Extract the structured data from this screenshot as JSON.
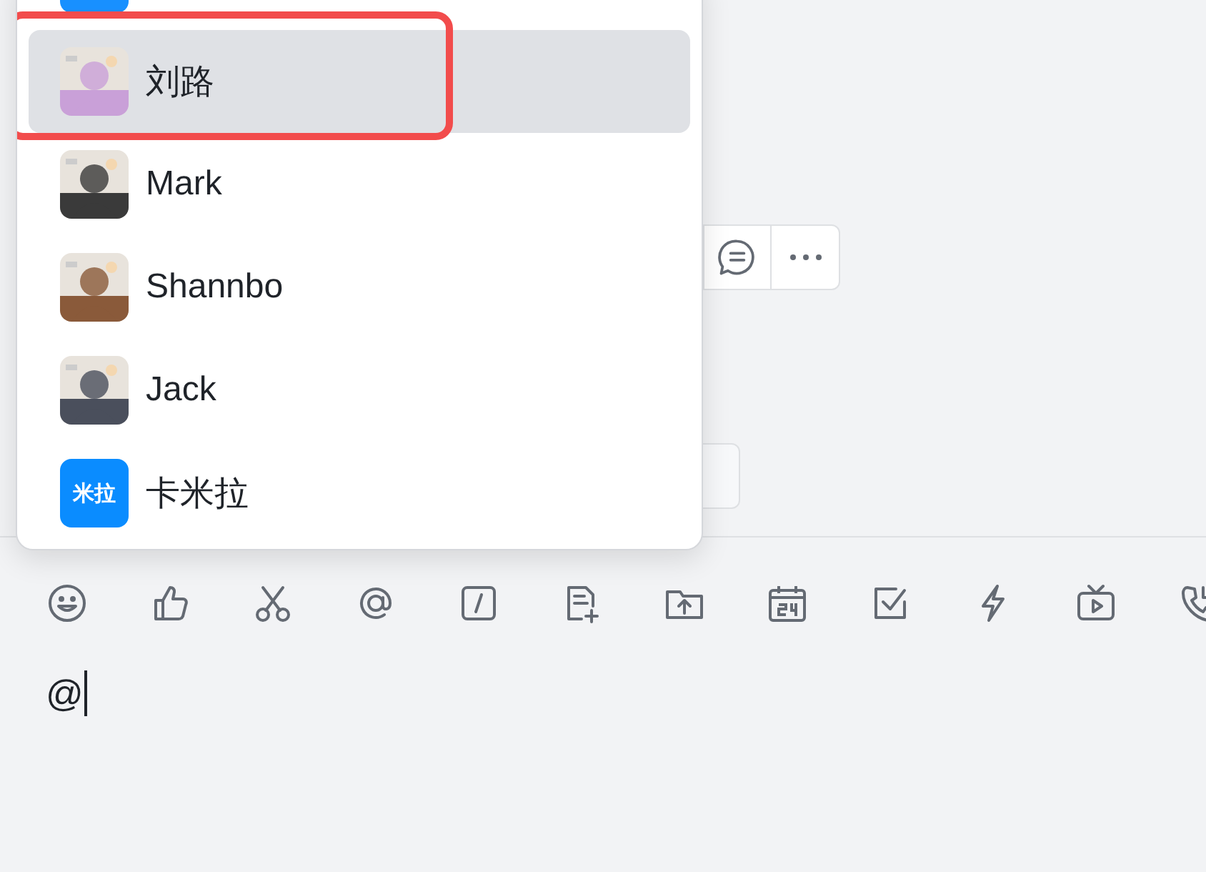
{
  "mention_popup": {
    "members": [
      {
        "selected": false,
        "avatar": {
          "kind": "tile",
          "color": "#1890ff"
        }
      },
      {
        "name": "刘路",
        "selected": true,
        "highlighted": true
      },
      {
        "name": "Mark",
        "selected": false
      },
      {
        "name": "Shannbo",
        "selected": false
      },
      {
        "name": "Jack",
        "selected": false
      },
      {
        "name": "卡米拉",
        "selected": false,
        "avatar": {
          "kind": "text",
          "text": "米拉",
          "color": "#0a8cff"
        }
      }
    ]
  },
  "composer": {
    "toolbar": [
      {
        "kind": "emoji"
      },
      {
        "kind": "like"
      },
      {
        "kind": "scissors"
      },
      {
        "kind": "at"
      },
      {
        "kind": "slash"
      },
      {
        "kind": "doc-add"
      },
      {
        "kind": "folder-upload"
      },
      {
        "kind": "calendar"
      },
      {
        "kind": "checkbox"
      },
      {
        "kind": "lightning"
      },
      {
        "kind": "tv"
      },
      {
        "kind": "phone"
      }
    ],
    "text": "@"
  }
}
